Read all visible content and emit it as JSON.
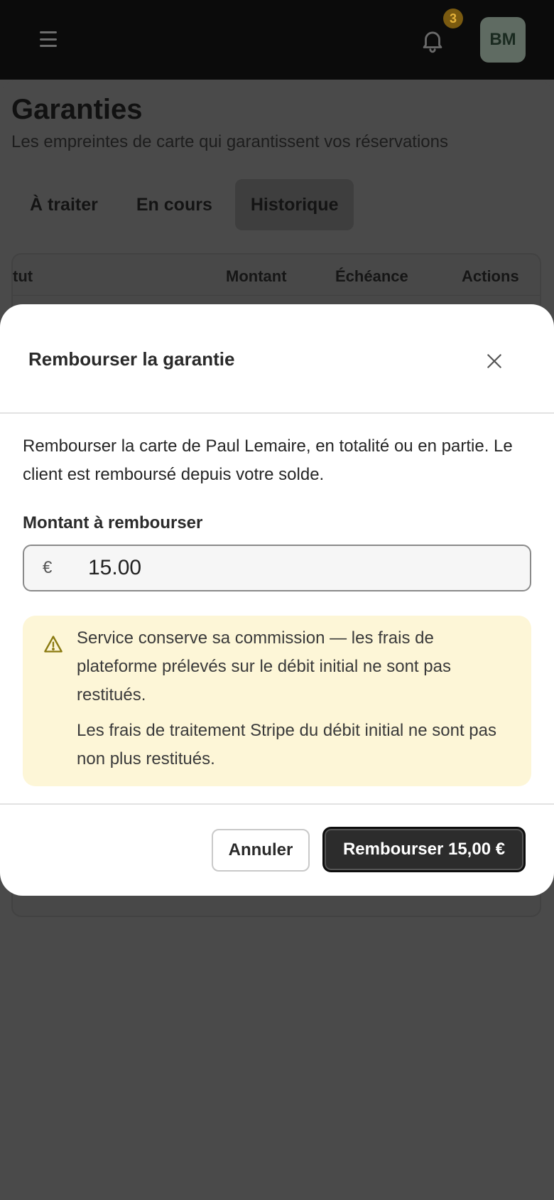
{
  "topbar": {
    "notifications_count": "3",
    "avatar_initials": "BM"
  },
  "page": {
    "title": "Garanties",
    "subtitle": "Les empreintes de carte qui garantissent vos réservations",
    "tabs": [
      {
        "label": "À traiter",
        "active": false
      },
      {
        "label": "En cours",
        "active": false
      },
      {
        "label": "Historique",
        "active": true
      }
    ],
    "table": {
      "columns": [
        "tut",
        "Montant",
        "Échéance",
        "Actions"
      ]
    }
  },
  "modal": {
    "title": "Rembourser la garantie",
    "description": "Rembourser la carte de Paul Lemaire, en totalité ou en partie. Le client est remboursé depuis votre solde.",
    "amount_label": "Montant à rembourser",
    "currency_symbol": "€",
    "amount_value": "15.00",
    "warning": {
      "line1": "Service conserve sa commission — les frais de plateforme prélevés sur le débit initial ne sont pas restitués.",
      "line2": "Les frais de traitement Stripe du débit initial ne sont pas non plus restitués."
    },
    "cancel_label": "Annuler",
    "confirm_label": "Rembourser 15,00 €"
  },
  "colors": {
    "topbar_bg": "#0b0b0b",
    "overlay_bg": "#4a4a4a",
    "warning_bg": "#fdf6d7",
    "warning_icon": "#8a7a10",
    "primary_button": "#2c2c2c",
    "badge": "#7a5a10"
  },
  "icons": {
    "menu": "menu-icon",
    "notifications": "bell-icon",
    "close": "close-icon",
    "warning": "warning-triangle-icon"
  }
}
